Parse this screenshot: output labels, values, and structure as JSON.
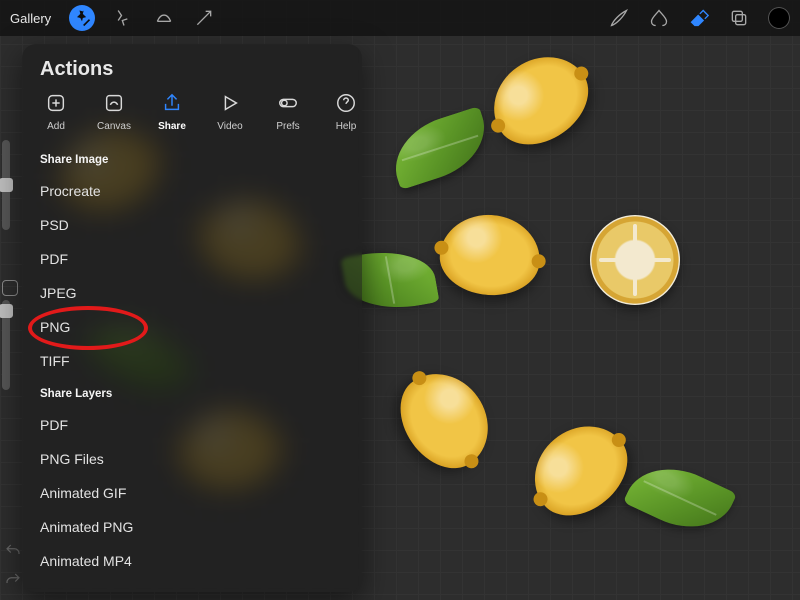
{
  "topbar": {
    "gallery_label": "Gallery"
  },
  "actions": {
    "title": "Actions",
    "tabs": [
      {
        "id": "add",
        "label": "Add"
      },
      {
        "id": "canvas",
        "label": "Canvas"
      },
      {
        "id": "share",
        "label": "Share"
      },
      {
        "id": "video",
        "label": "Video"
      },
      {
        "id": "prefs",
        "label": "Prefs"
      },
      {
        "id": "help",
        "label": "Help"
      }
    ],
    "selected_tab": "share",
    "sections": [
      {
        "header": "Share Image",
        "items": [
          "Procreate",
          "PSD",
          "PDF",
          "JPEG",
          "PNG",
          "TIFF"
        ]
      },
      {
        "header": "Share Layers",
        "items": [
          "PDF",
          "PNG Files",
          "Animated GIF",
          "Animated PNG",
          "Animated MP4"
        ]
      }
    ],
    "highlighted_item": "PNG"
  },
  "colors": {
    "accent": "#2f86ff",
    "highlight": "#e21a1a"
  }
}
